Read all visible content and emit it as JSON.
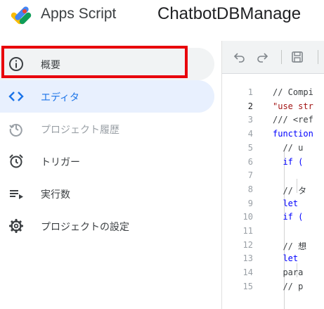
{
  "header": {
    "brand": "Apps Script",
    "project_title": "ChatbotDBManage"
  },
  "sidebar": {
    "items": [
      {
        "label": "概要",
        "icon": "info-icon"
      },
      {
        "label": "エディタ",
        "icon": "code-icon"
      },
      {
        "label": "プロジェクト履歴",
        "icon": "history-icon"
      },
      {
        "label": "トリガー",
        "icon": "alarm-clock-icon"
      },
      {
        "label": "実行数",
        "icon": "executions-list-icon"
      },
      {
        "label": "プロジェクトの設定",
        "icon": "gear-icon"
      }
    ]
  },
  "editor": {
    "toolbar": [
      "undo-icon",
      "redo-icon",
      "save-icon"
    ],
    "lines": [
      {
        "num": "1",
        "text": "// Compi"
      },
      {
        "num": "2",
        "text": "\"use str"
      },
      {
        "num": "3",
        "text": "/// <ref"
      },
      {
        "num": "4",
        "text": "function"
      },
      {
        "num": "5",
        "text": "  // u"
      },
      {
        "num": "6",
        "text": "  if ("
      },
      {
        "num": "7",
        "text": ""
      },
      {
        "num": "8",
        "text": "  // タ"
      },
      {
        "num": "9",
        "text": "  let"
      },
      {
        "num": "10",
        "text": "  if ("
      },
      {
        "num": "11",
        "text": ""
      },
      {
        "num": "12",
        "text": "  // 想"
      },
      {
        "num": "13",
        "text": "  let"
      },
      {
        "num": "14",
        "text": "  para"
      },
      {
        "num": "15",
        "text": "  // p"
      }
    ]
  },
  "colors": {
    "accent": "#1a73e8",
    "highlight": "#e8000b",
    "string": "#a31515",
    "keyword": "#0000ff"
  }
}
